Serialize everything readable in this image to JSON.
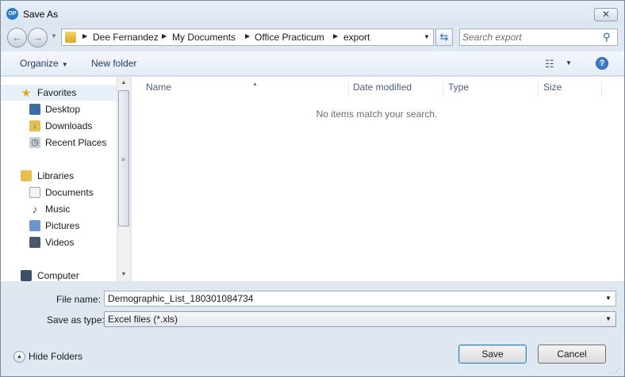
{
  "window": {
    "title": "Save As",
    "app_icon_text": "OP",
    "close_label": "✕"
  },
  "nav": {
    "back_icon": "←",
    "forward_icon": "→",
    "breadcrumb": [
      "Dee Fernandez",
      "My Documents",
      "Office Practicum",
      "export"
    ],
    "search_placeholder": "Search export"
  },
  "toolbar": {
    "organize_label": "Organize",
    "new_folder_label": "New folder",
    "help_label": "?"
  },
  "sidebar": {
    "items": [
      {
        "label": "Favorites",
        "icon": "star-icon",
        "group": true
      },
      {
        "label": "Desktop",
        "icon": "desktop-icon"
      },
      {
        "label": "Downloads",
        "icon": "downloads-icon"
      },
      {
        "label": "Recent Places",
        "icon": "recent-places-icon"
      },
      {
        "label": "Libraries",
        "icon": "libraries-icon",
        "group": true
      },
      {
        "label": "Documents",
        "icon": "documents-icon"
      },
      {
        "label": "Music",
        "icon": "music-icon"
      },
      {
        "label": "Pictures",
        "icon": "pictures-icon"
      },
      {
        "label": "Videos",
        "icon": "videos-icon"
      },
      {
        "label": "Computer",
        "icon": "computer-icon",
        "group": true
      }
    ]
  },
  "filelist": {
    "columns": [
      "Name",
      "Date modified",
      "Type",
      "Size"
    ],
    "empty_message": "No items match your search."
  },
  "form": {
    "file_name_label": "File name:",
    "file_name_value": "Demographic_List_180301084734",
    "save_as_type_label": "Save as type:",
    "save_as_type_value": "Excel files (*.xls)",
    "hide_folders_label": "Hide Folders",
    "save_label": "Save",
    "cancel_label": "Cancel"
  },
  "colors": {
    "accent": "#1e57a6",
    "window_bg": "#dfe7f1"
  }
}
